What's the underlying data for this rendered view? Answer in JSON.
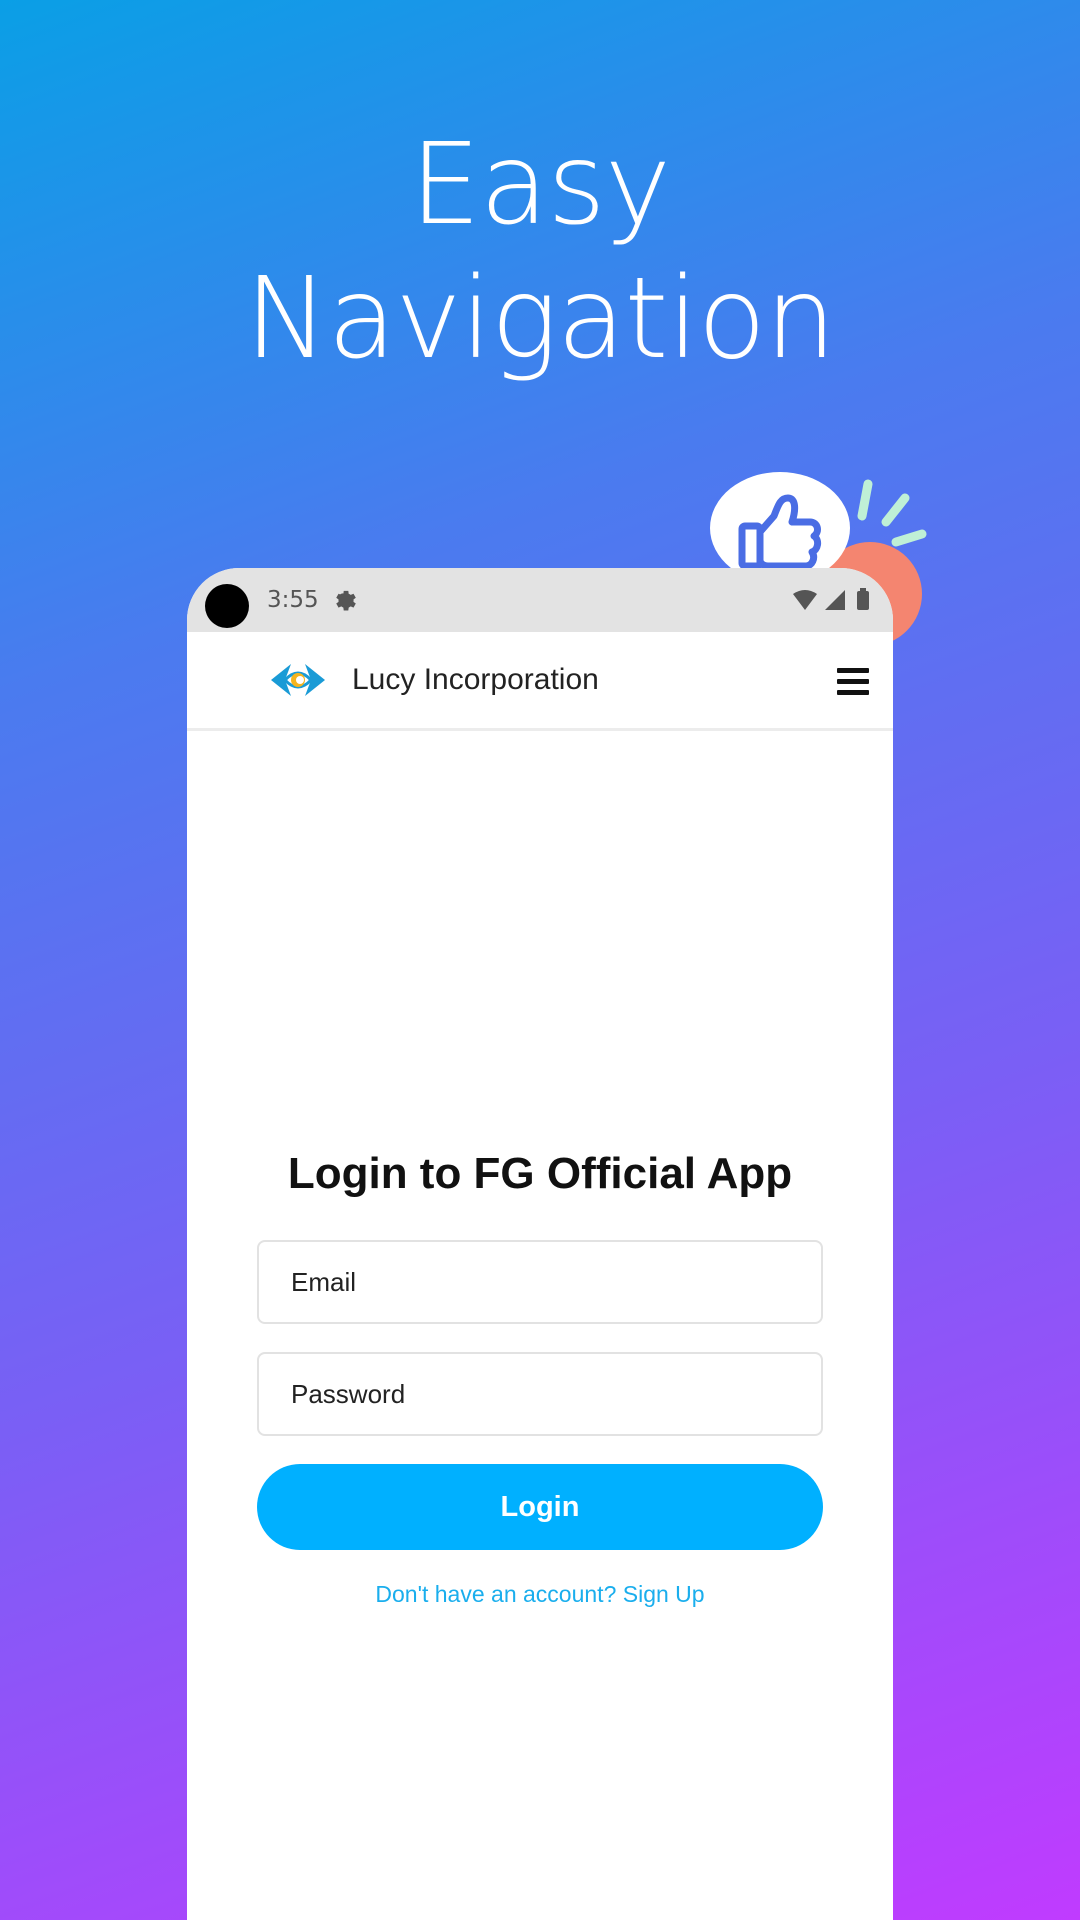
{
  "headline": {
    "line1": "Easy",
    "line2": "Navigation"
  },
  "status_bar": {
    "time": "3:55"
  },
  "app_bar": {
    "title": "Lucy Incorporation"
  },
  "login": {
    "title": "Login to FG Official App",
    "email_placeholder": "Email",
    "password_placeholder": "Password",
    "button_label": "Login",
    "signup_text": "Don't have an account? Sign Up"
  },
  "icons": {
    "decoration": "thumbs-up-icon",
    "status": [
      "gear-icon",
      "wifi-icon",
      "signal-icon",
      "battery-icon"
    ],
    "logo": "lucy-logo",
    "menu": "hamburger-menu-icon"
  },
  "colors": {
    "accent": "#00b0ff",
    "link": "#1aaeed",
    "gradient_start": "#0a9fe6",
    "gradient_end": "#c03bff",
    "status_bar_bg": "#e3e3e3"
  }
}
